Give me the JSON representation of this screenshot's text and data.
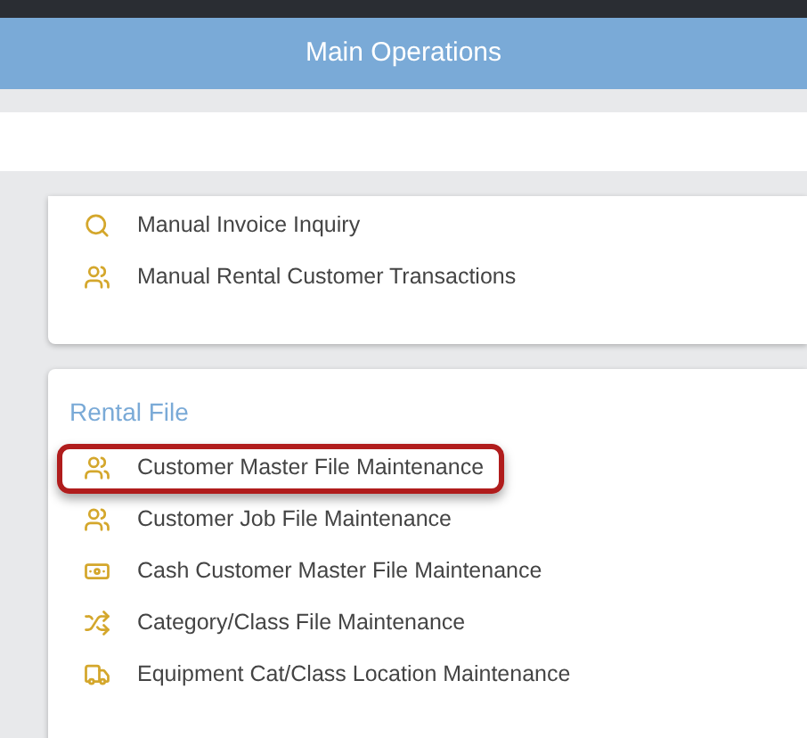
{
  "header": {
    "title": "Main Operations"
  },
  "sections": [
    {
      "items": [
        {
          "label": "Manual Invoice Inquiry",
          "kind": "search",
          "highlighted": false
        },
        {
          "label": "Manual Rental Customer Transactions",
          "kind": "users",
          "highlighted": false
        }
      ]
    },
    {
      "title": "Rental File",
      "items": [
        {
          "label": "Customer Master File Maintenance",
          "kind": "users",
          "highlighted": true
        },
        {
          "label": "Customer Job File Maintenance",
          "kind": "users",
          "highlighted": false
        },
        {
          "label": "Cash Customer Master File Maintenance",
          "kind": "cash",
          "highlighted": false
        },
        {
          "label": "Category/Class File Maintenance",
          "kind": "shuffle",
          "highlighted": false
        },
        {
          "label": "Equipment Cat/Class Location Maintenance",
          "kind": "truck",
          "highlighted": false
        }
      ]
    }
  ]
}
